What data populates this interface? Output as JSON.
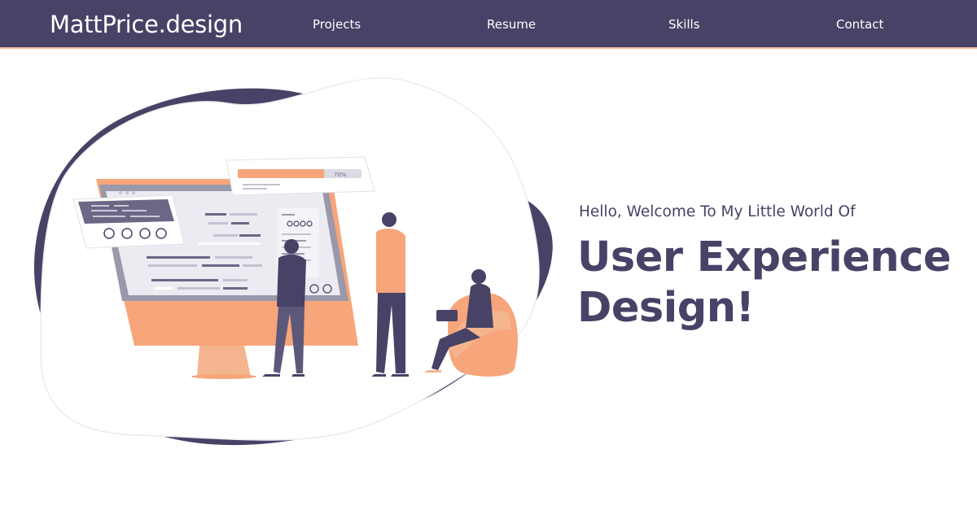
{
  "header": {
    "brand": "MattPrice.design",
    "nav": [
      {
        "label": "Projects"
      },
      {
        "label": "Resume"
      },
      {
        "label": "Skills"
      },
      {
        "label": "Contact"
      }
    ]
  },
  "hero": {
    "greeting": "Hello, Welcome To My Little World Of",
    "headline_line1": "User Experience",
    "headline_line2": "Design!",
    "illustration": {
      "progress_label": "70%",
      "progress_value": 0.7
    }
  },
  "colors": {
    "navy": "#474266",
    "accent_line": "#f2b59a",
    "orange": "#f7a57a",
    "white": "#ffffff"
  }
}
